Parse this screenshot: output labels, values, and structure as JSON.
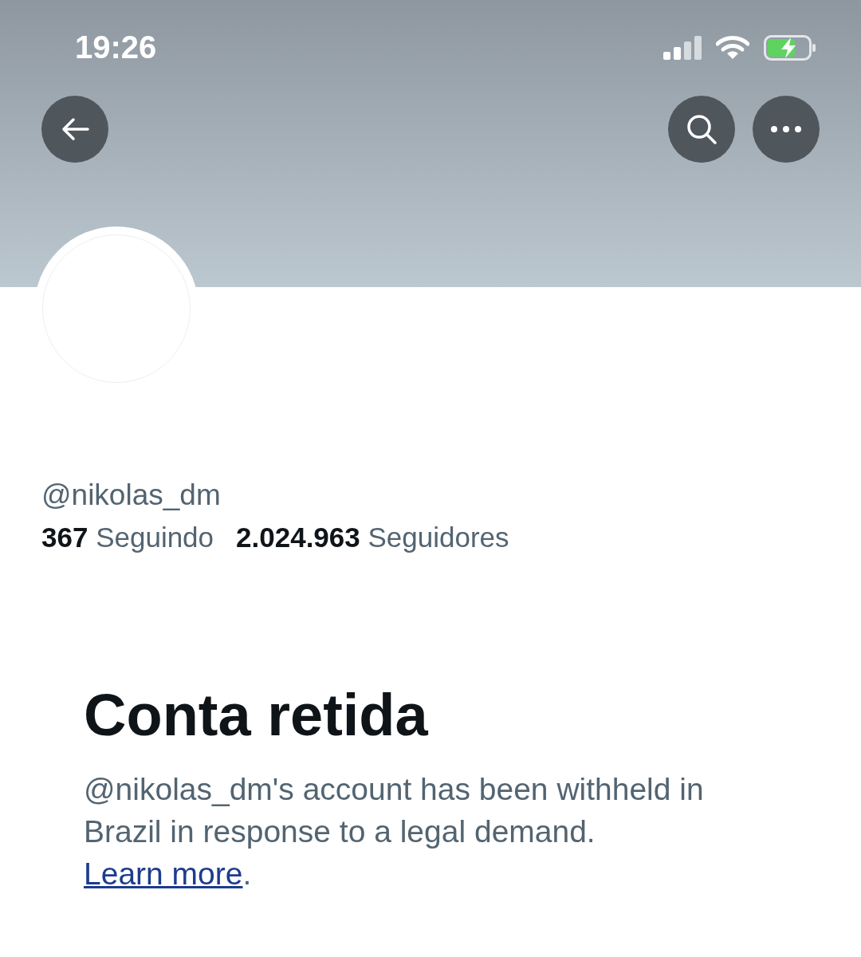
{
  "status_bar": {
    "time": "19:26"
  },
  "profile": {
    "handle": "@nikolas_dm",
    "following_count": "367",
    "following_label": "Seguindo",
    "followers_count": "2.024.963",
    "followers_label": "Seguidores"
  },
  "notice": {
    "title": "Conta retida",
    "message": "@nikolas_dm's account has been withheld in Brazil in response to a legal demand.",
    "link": "Learn more",
    "link_suffix": "."
  }
}
